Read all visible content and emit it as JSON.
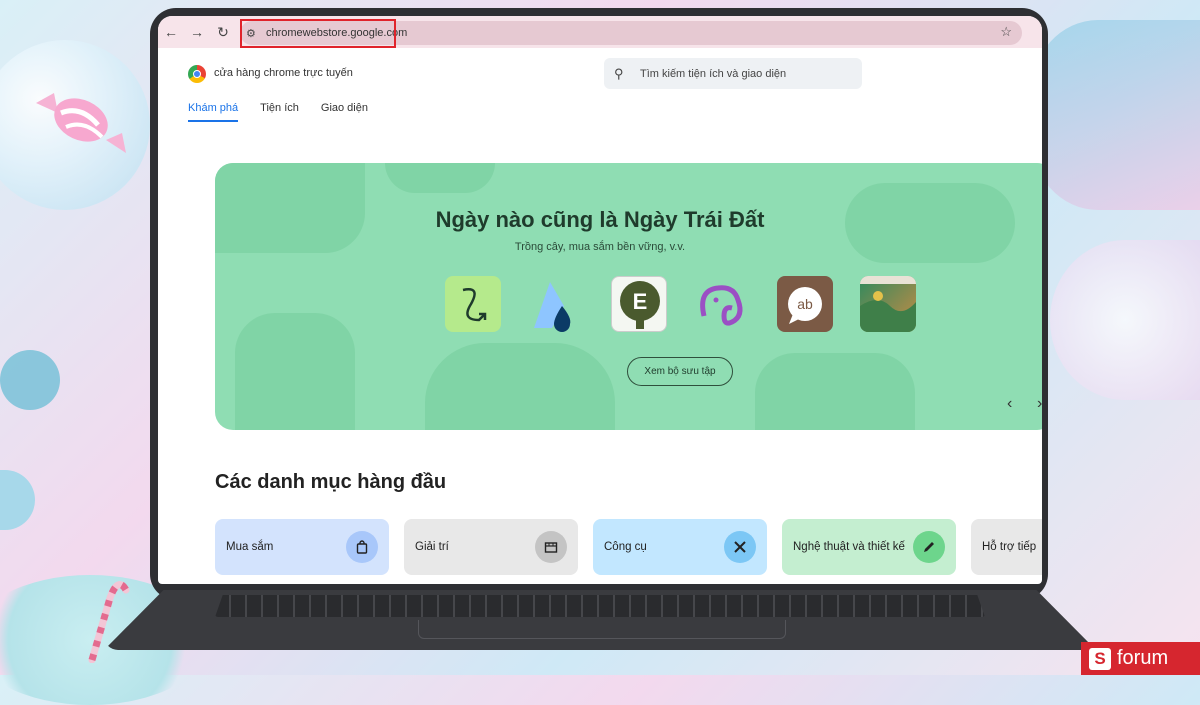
{
  "browser": {
    "url": "chromewebstore.google.com",
    "back_icon": "←",
    "forward_icon": "→",
    "reload_icon": "↻",
    "star_icon": "☆"
  },
  "store": {
    "name": "cửa hàng chrome trực tuyến",
    "search_placeholder": "Tìm kiếm tiện ích và giao diện"
  },
  "tabs": [
    {
      "label": "Khám phá",
      "active": true
    },
    {
      "label": "Tiện ích",
      "active": false
    },
    {
      "label": "Giao diện",
      "active": false
    }
  ],
  "banner": {
    "title": "Ngày nào cũng là Ngày Trái Đất",
    "subtitle": "Trồng cây, mua sắm bền vững, v.v.",
    "collection_button": "Xem bộ sưu tập",
    "apps": [
      "swirl-arrow-app-icon",
      "water-drop-app-icon",
      "tree-e-app-icon",
      "elephant-app-icon",
      "ab-speech-app-icon",
      "nature-photo-app-icon"
    ],
    "app5_text": "ab",
    "app3_text": "E"
  },
  "categories": {
    "heading": "Các danh mục hàng đầu",
    "items": [
      {
        "label": "Mua sắm",
        "icon": "shopping-bag-icon",
        "bg": "#d3e3fd",
        "icon_bg": "#a8c7fa"
      },
      {
        "label": "Giải trí",
        "icon": "film-icon",
        "bg": "#e8e8e8",
        "icon_bg": "#c4c4c4"
      },
      {
        "label": "Công cụ",
        "icon": "tools-icon",
        "bg": "#c2e7ff",
        "icon_bg": "#7cc7f5"
      },
      {
        "label": "Nghệ thuật và thiết kế",
        "icon": "pencil-icon",
        "bg": "#c4eed0",
        "icon_bg": "#6dd58c"
      },
      {
        "label": "Hỗ trợ tiếp",
        "icon": "accessibility-icon",
        "bg": "#e8e8e8",
        "icon_bg": "#c4c4c4"
      }
    ]
  },
  "watermark": {
    "letter": "S",
    "text": "forum"
  },
  "colors": {
    "accent": "#1a73e8",
    "banner": "#8fddb3",
    "highlight": "#e0232b"
  }
}
